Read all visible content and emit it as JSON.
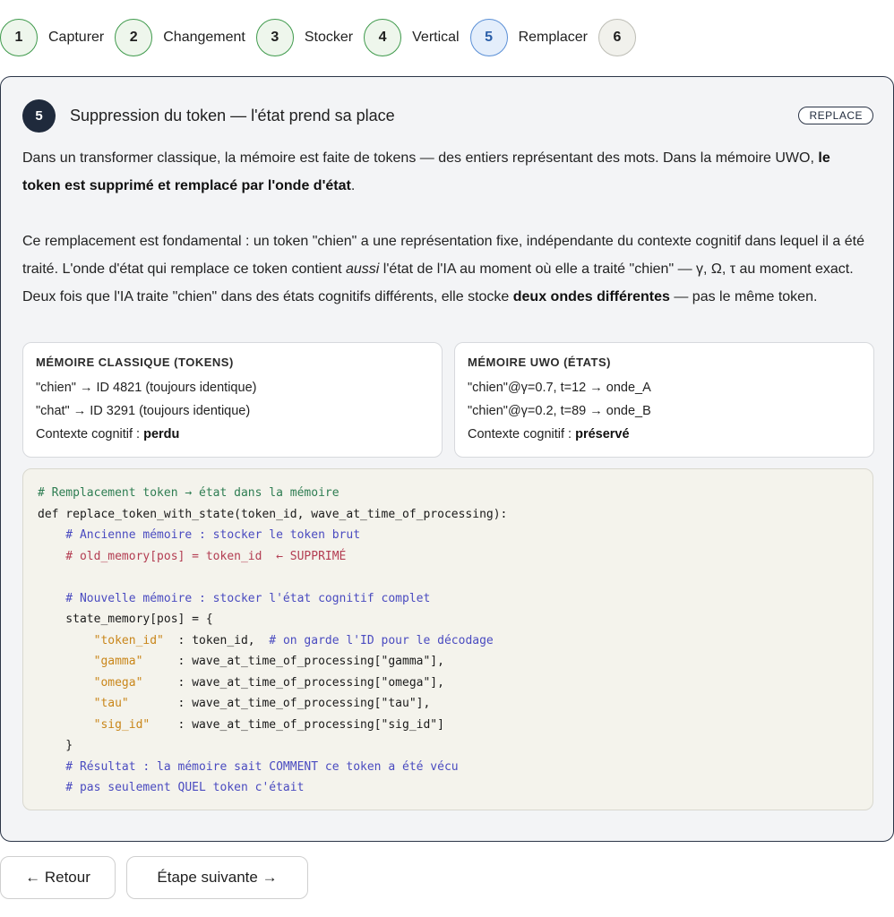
{
  "stepper": [
    {
      "num": "1",
      "label": "Capturer"
    },
    {
      "num": "2",
      "label": "Changement"
    },
    {
      "num": "3",
      "label": "Stocker"
    },
    {
      "num": "4",
      "label": "Vertical"
    },
    {
      "num": "5",
      "label": "Remplacer"
    },
    {
      "num": "6",
      "label": ""
    }
  ],
  "card": {
    "badge": "5",
    "title": "Suppression du token — l'état prend sa place",
    "tag": "REPLACE",
    "p1_a": "Dans un transformer classique, la mémoire est faite de tokens — des entiers représentant des mots. Dans la mémoire UWO, ",
    "p1_b": "le token est supprimé et remplacé par l'onde d'état",
    "p1_c": ".",
    "p2_a": "Ce remplacement est fondamental : un token \"chien\" a une représentation fixe, indépendante du contexte cognitif dans lequel il a été traité. L'onde d'état qui remplace ce token contient ",
    "p2_em": "aussi",
    "p2_b": " l'état de l'IA au moment où elle a traité \"chien\" — γ, Ω, τ au moment exact. Deux fois que l'IA traite \"chien\" dans des états cognitifs différents, elle stocke ",
    "p2_strong": "deux ondes différentes",
    "p2_c": " — pas le même token."
  },
  "memory_classic": {
    "title": "MÉMOIRE CLASSIQUE (TOKENS)",
    "line1": "\"chien\" → ID 4821 (toujours identique)",
    "line2": "\"chat\" → ID 3291 (toujours identique)",
    "line3_label": "Contexte cognitif : ",
    "line3_value": "perdu"
  },
  "memory_uwo": {
    "title": "MÉMOIRE UWO (ÉTATS)",
    "line1": "\"chien\"@γ=0.7, t=12 → onde_A",
    "line2": "\"chien\"@γ=0.2, t=89 → onde_B",
    "line3_label": "Contexte cognitif : ",
    "line3_value": "préservé"
  },
  "code": {
    "l1": "# Remplacement token → état dans la mémoire",
    "l2": "def replace_token_with_state(token_id, wave_at_time_of_processing):",
    "l3": "    # Ancienne mémoire : stocker le token brut",
    "l4": "    # old_memory[pos] = token_id  ← SUPPRIMÉ",
    "l5": "",
    "l6": "    # Nouvelle mémoire : stocker l'état cognitif complet",
    "l7": "    state_memory[pos] = {",
    "l8_key": "        \"token_id\"",
    "l8_rest": "  : token_id,  ",
    "l8_comment": "# on garde l'ID pour le décodage",
    "l9_key": "        \"gamma\"",
    "l9_rest": "     : wave_at_time_of_processing[\"gamma\"],",
    "l10_key": "        \"omega\"",
    "l10_rest": "     : wave_at_time_of_processing[\"omega\"],",
    "l11_key": "        \"tau\"",
    "l11_rest": "       : wave_at_time_of_processing[\"tau\"],",
    "l12_key": "        \"sig_id\"",
    "l12_rest": "    : wave_at_time_of_processing[\"sig_id\"]",
    "l13": "    }",
    "l14": "    # Résultat : la mémoire sait COMMENT ce token a été vécu",
    "l15": "    # pas seulement QUEL token c'était"
  },
  "buttons": {
    "back": "← Retour",
    "next": "Étape suivante →"
  }
}
